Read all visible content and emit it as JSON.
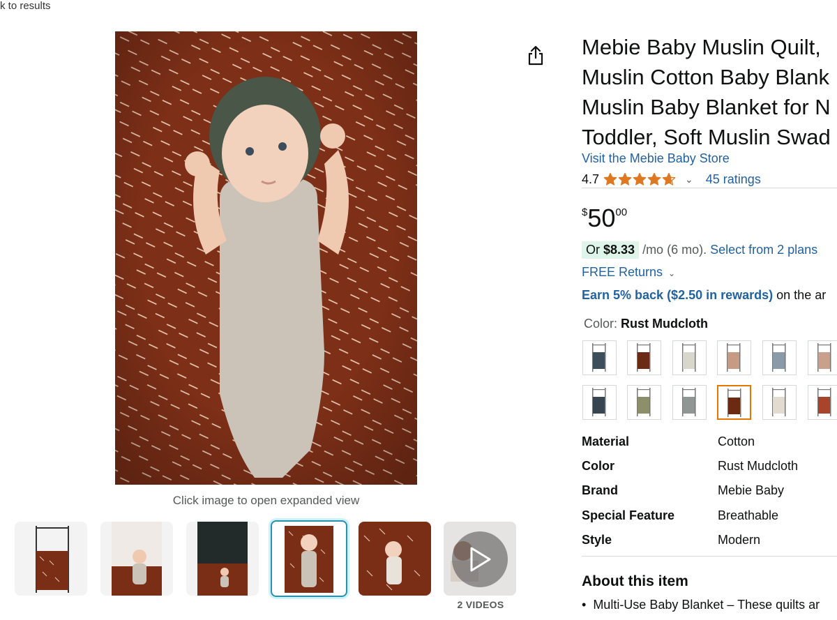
{
  "nav": {
    "back_label": "k to results"
  },
  "gallery": {
    "expand_hint": "Click image to open expanded view",
    "videos_label": "2 VIDEOS"
  },
  "product": {
    "title_lines": [
      "Mebie Baby Muslin Quilt,",
      "Muslin Cotton Baby Blank",
      "Muslin Baby Blanket for N",
      "Toddler, Soft Muslin Swad"
    ],
    "store_link": "Visit the Mebie Baby Store",
    "rating": "4.7",
    "rating_stars": 4.7,
    "ratings_count": "45 ratings"
  },
  "price": {
    "symbol": "$",
    "whole": "50",
    "fraction": "00"
  },
  "monthly": {
    "or": "Or",
    "amount": "$8.33",
    "term": "/mo (6 mo).",
    "plans_link": "Select from 2 plans"
  },
  "returns": {
    "label": "FREE Returns"
  },
  "rewards": {
    "bold": "Earn 5% back ($2.50 in rewards)",
    "rest": "on the ar"
  },
  "color": {
    "label": "Color:",
    "selected": "Rust Mudcloth"
  },
  "specs": [
    {
      "key": "Material",
      "value": "Cotton"
    },
    {
      "key": "Color",
      "value": "Rust Mudcloth"
    },
    {
      "key": "Brand",
      "value": "Mebie Baby"
    },
    {
      "key": "Special Feature",
      "value": "Breathable"
    },
    {
      "key": "Style",
      "value": "Modern"
    }
  ],
  "about": {
    "heading": "About this item",
    "bullet_1": "Multi-Use Baby Blanket – These quilts ar"
  },
  "colors": {
    "rust": "#7a2e16",
    "link": "#2162A1",
    "star": "#DE7921",
    "selected_thumb": "#2E8EAE",
    "selected_swatch": "#E77600",
    "monthly_pill": "#dff5e9"
  },
  "icons": [
    "share-icon",
    "star-icon",
    "chevron-down-icon",
    "play-icon"
  ]
}
